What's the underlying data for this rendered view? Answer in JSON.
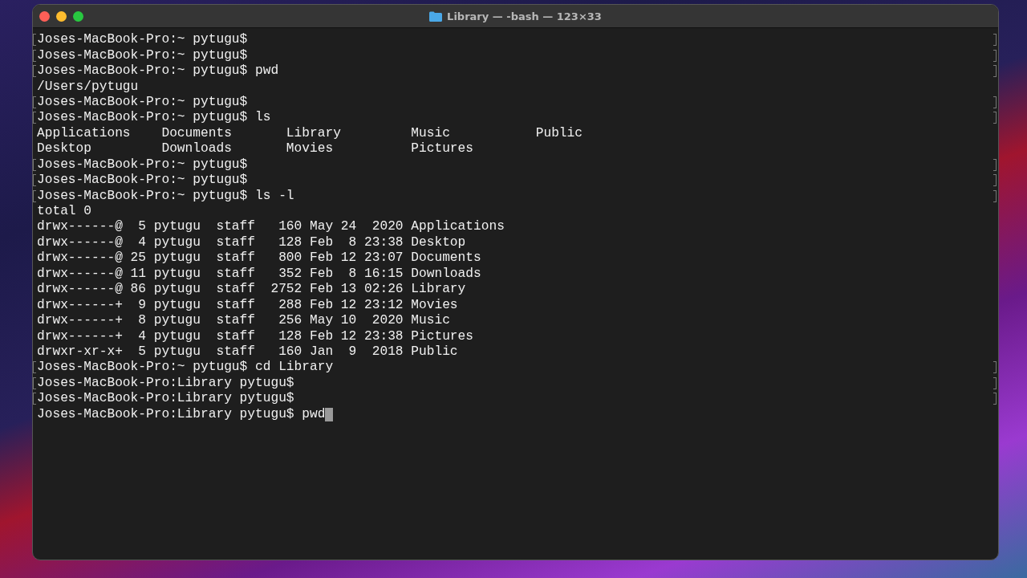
{
  "window": {
    "title": "Library — -bash — 123×33",
    "cursor": true
  },
  "lines": [
    {
      "kind": "prompt",
      "text": "Joses-MacBook-Pro:~ pytugu$"
    },
    {
      "kind": "prompt",
      "text": "Joses-MacBook-Pro:~ pytugu$"
    },
    {
      "kind": "prompt",
      "text": "Joses-MacBook-Pro:~ pytugu$ pwd"
    },
    {
      "kind": "output",
      "text": "/Users/pytugu"
    },
    {
      "kind": "prompt",
      "text": "Joses-MacBook-Pro:~ pytugu$"
    },
    {
      "kind": "prompt",
      "text": "Joses-MacBook-Pro:~ pytugu$ ls"
    },
    {
      "kind": "output",
      "text": "Applications    Documents       Library         Music           Public"
    },
    {
      "kind": "output",
      "text": "Desktop         Downloads       Movies          Pictures"
    },
    {
      "kind": "prompt",
      "text": "Joses-MacBook-Pro:~ pytugu$"
    },
    {
      "kind": "prompt",
      "text": "Joses-MacBook-Pro:~ pytugu$"
    },
    {
      "kind": "prompt",
      "text": "Joses-MacBook-Pro:~ pytugu$ ls -l"
    },
    {
      "kind": "output",
      "text": "total 0"
    },
    {
      "kind": "output",
      "text": "drwx------@  5 pytugu  staff   160 May 24  2020 Applications"
    },
    {
      "kind": "output",
      "text": "drwx------@  4 pytugu  staff   128 Feb  8 23:38 Desktop"
    },
    {
      "kind": "output",
      "text": "drwx------@ 25 pytugu  staff   800 Feb 12 23:07 Documents"
    },
    {
      "kind": "output",
      "text": "drwx------@ 11 pytugu  staff   352 Feb  8 16:15 Downloads"
    },
    {
      "kind": "output",
      "text": "drwx------@ 86 pytugu  staff  2752 Feb 13 02:26 Library"
    },
    {
      "kind": "output",
      "text": "drwx------+  9 pytugu  staff   288 Feb 12 23:12 Movies"
    },
    {
      "kind": "output",
      "text": "drwx------+  8 pytugu  staff   256 May 10  2020 Music"
    },
    {
      "kind": "output",
      "text": "drwx------+  4 pytugu  staff   128 Feb 12 23:38 Pictures"
    },
    {
      "kind": "output",
      "text": "drwxr-xr-x+  5 pytugu  staff   160 Jan  9  2018 Public"
    },
    {
      "kind": "prompt",
      "text": "Joses-MacBook-Pro:~ pytugu$ cd Library"
    },
    {
      "kind": "prompt",
      "text": "Joses-MacBook-Pro:Library pytugu$"
    },
    {
      "kind": "prompt",
      "text": "Joses-MacBook-Pro:Library pytugu$"
    },
    {
      "kind": "current",
      "text": "Joses-MacBook-Pro:Library pytugu$ pwd"
    }
  ]
}
